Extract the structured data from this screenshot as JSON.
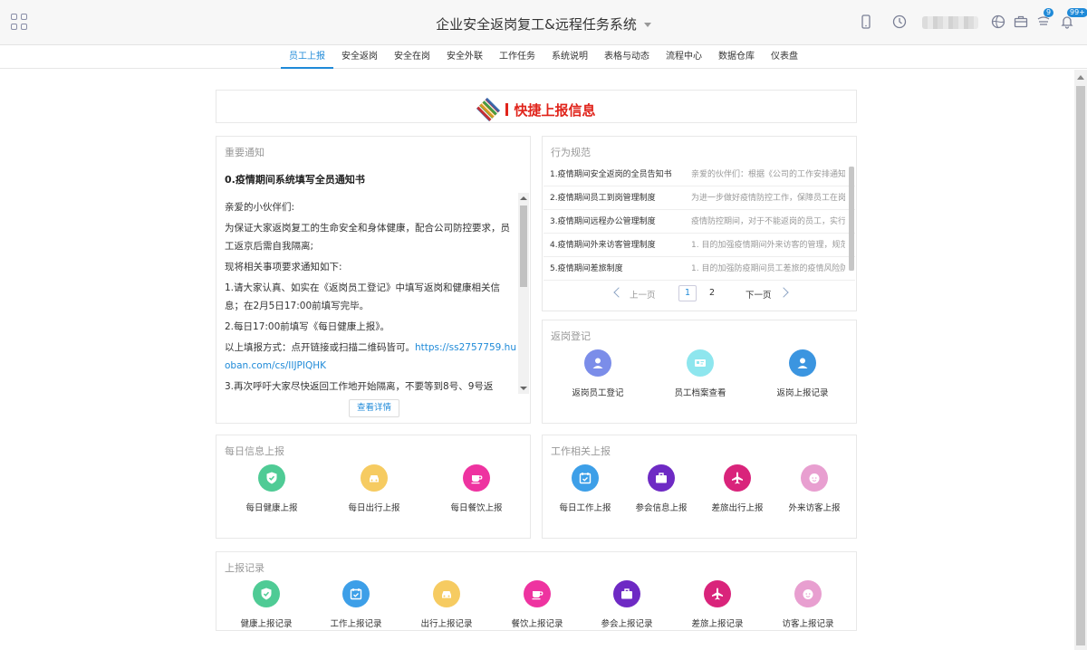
{
  "header": {
    "title": "企业安全返岗复工&远程任务系统",
    "badges": {
      "message": "9",
      "notice": "99+"
    }
  },
  "nav": {
    "tabs": [
      "员工上报",
      "安全返岗",
      "安全在岗",
      "安全外联",
      "工作任务",
      "系统说明",
      "表格与动态",
      "流程中心",
      "数据仓库",
      "仪表盘"
    ]
  },
  "banner": {
    "text": "快捷上报信息"
  },
  "notice": {
    "title": "重要通知",
    "heading": "0.疫情期间系统填写全员通知书",
    "p1": "亲爱的小伙伴们:",
    "p2": "为保证大家返岗复工的生命安全和身体健康，配合公司防控要求，员工返京后需自我隔离;",
    "p3": "现将相关事项要求通知如下:",
    "p4": "1.请大家认真、如实在《返岗员工登记》中填写返岗和健康相关信息；在2月5日17:00前填写完毕。",
    "p5": "2.每日17:00前填写《每日健康上报》。",
    "p6": "以上填报方式：点开链接或扫描二维码皆可。",
    "link": "https://ss2757759.huoban.com/cs/IIJPIQHK",
    "p7": "3.再次呼吁大家尽快返回工作地开始隔离，不要等到8号、9号返",
    "detail_button": "查看详情"
  },
  "rules": {
    "title": "行为规范",
    "items": [
      {
        "title": "1.疫情期间安全返岗的全员告知书",
        "desc": "亲爱的伙伴们：根据《公司的工作安排通知"
      },
      {
        "title": "2.疫情期间员工到岗管理制度",
        "desc": "为进一步做好疫情防控工作，保障员工在岗"
      },
      {
        "title": "3.疫情期间远程办公管理制度",
        "desc": "疫情防控期间，对于不能返岗的员工，实行"
      },
      {
        "title": "4.疫情期间外来访客管理制度",
        "desc": "1. 目的加强疫情期间外来访客的管理，规范"
      },
      {
        "title": "5.疫情期间差旅制度",
        "desc": "1. 目的加强防疫期间员工差旅的疫情风险防"
      }
    ],
    "pager": {
      "prev": "上一页",
      "page1": "1",
      "page2": "2",
      "next": "下一页"
    }
  },
  "return_section": {
    "title": "返岗登记",
    "items": [
      {
        "label": "返岗员工登记",
        "color": "#7b8de9",
        "icon": "person-icon"
      },
      {
        "label": "员工档案查看",
        "color": "#8ee6ee",
        "icon": "id-card-icon"
      },
      {
        "label": "返岗上报记录",
        "color": "#3b95e0",
        "icon": "person-icon"
      }
    ]
  },
  "daily_section": {
    "title": "每日信息上报",
    "items": [
      {
        "label": "每日健康上报",
        "color": "#4fcb95",
        "icon": "shield-check-icon"
      },
      {
        "label": "每日出行上报",
        "color": "#f6cb61",
        "icon": "car-icon"
      },
      {
        "label": "每日餐饮上报",
        "color": "#ee33a0",
        "icon": "coffee-icon"
      }
    ]
  },
  "work_section": {
    "title": "工作相关上报",
    "items": [
      {
        "label": "每日工作上报",
        "color": "#3d9fe8",
        "icon": "calendar-check-icon"
      },
      {
        "label": "参会信息上报",
        "color": "#6e2ac4",
        "icon": "briefcase-icon"
      },
      {
        "label": "差旅出行上报",
        "color": "#d9247b",
        "icon": "airplane-icon"
      },
      {
        "label": "外来访客上报",
        "color": "#e89fd0",
        "icon": "face-icon"
      }
    ]
  },
  "records_section": {
    "title": "上报记录",
    "items": [
      {
        "label": "健康上报记录",
        "color": "#4fcb95",
        "icon": "shield-check-icon"
      },
      {
        "label": "工作上报记录",
        "color": "#3d9fe8",
        "icon": "calendar-check-icon"
      },
      {
        "label": "出行上报记录",
        "color": "#f6cb61",
        "icon": "car-icon"
      },
      {
        "label": "餐饮上报记录",
        "color": "#ee33a0",
        "icon": "coffee-icon"
      },
      {
        "label": "参会上报记录",
        "color": "#6e2ac4",
        "icon": "briefcase-icon"
      },
      {
        "label": "差旅上报记录",
        "color": "#d9247b",
        "icon": "airplane-icon"
      },
      {
        "label": "访客上报记录",
        "color": "#e89fd0",
        "icon": "face-icon"
      }
    ]
  },
  "colors": {
    "accent": "#1f8ad8",
    "banner": "#e0241b"
  }
}
